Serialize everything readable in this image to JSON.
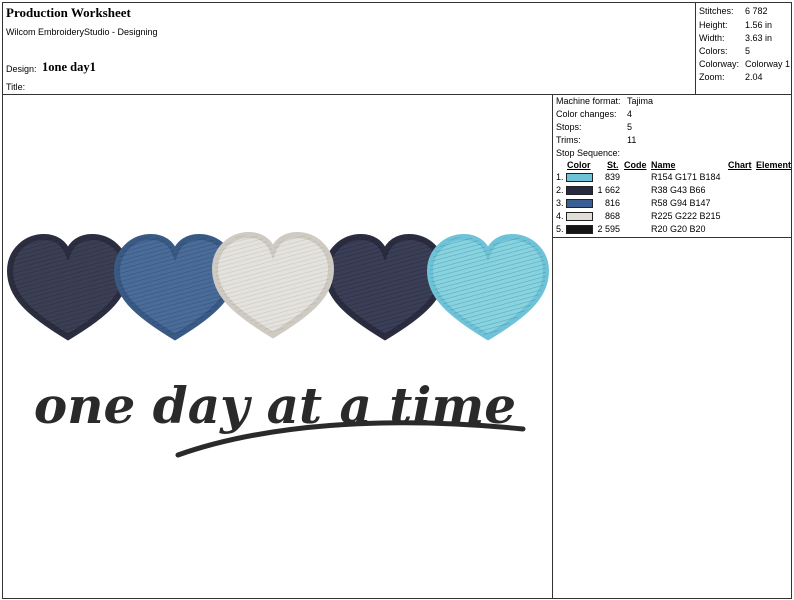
{
  "header": {
    "title": "Production Worksheet",
    "software": "Wilcom EmbroideryStudio - Designing",
    "design_label": "Design:",
    "design_name": "1one day1",
    "title_label": "Title:"
  },
  "stats": [
    {
      "label": "Stitches:",
      "value": "6 782"
    },
    {
      "label": "Height:",
      "value": "1.56 in"
    },
    {
      "label": "Width:",
      "value": "3.63 in"
    },
    {
      "label": "Colors:",
      "value": "5"
    },
    {
      "label": "Colorway:",
      "value": "Colorway 1"
    },
    {
      "label": "Zoom:",
      "value": "2.04"
    }
  ],
  "machine": [
    {
      "label": "Machine format:",
      "value": "Tajima"
    },
    {
      "label": "Color changes:",
      "value": "4"
    },
    {
      "label": "Stops:",
      "value": "5"
    },
    {
      "label": "Trims:",
      "value": "11"
    }
  ],
  "stop_sequence": {
    "title": "Stop Sequence:",
    "columns": [
      "#",
      "Color",
      "St.",
      "Code",
      "Name",
      "Chart",
      "Element"
    ],
    "rows": [
      {
        "num": "1.",
        "color": "#9AABB8",
        "swatch": "#6EC3D8",
        "stitches": "839",
        "code": "",
        "name": "R154 G171 B184"
      },
      {
        "num": "2.",
        "color": "#262B42",
        "swatch": "#262B42",
        "stitches": "1 662",
        "code": "",
        "name": "R38 G43 B66"
      },
      {
        "num": "3.",
        "color": "#3A5E93",
        "swatch": "#3A5E93",
        "stitches": "816",
        "code": "",
        "name": "R58 G94 B147"
      },
      {
        "num": "4.",
        "color": "#E1DED7",
        "swatch": "#E1DED7",
        "stitches": "868",
        "code": "",
        "name": "R225 G222 B215"
      },
      {
        "num": "5.",
        "color": "#141414",
        "swatch": "#141414",
        "stitches": "2 595",
        "code": "",
        "name": "R20 G20 B20"
      }
    ]
  },
  "design_preview": {
    "hearts": [
      {
        "color": "#3B3F54",
        "name": "navy-heart"
      },
      {
        "color": "#4A6C9A",
        "name": "blue-heart"
      },
      {
        "color": "#E4E2DD",
        "name": "white-heart"
      },
      {
        "color": "#3A3E56",
        "name": "dark-navy-heart"
      },
      {
        "color": "#86D4E2",
        "name": "light-blue-heart"
      }
    ],
    "text": "one day at a time",
    "text_color": "#2A2A2A"
  }
}
